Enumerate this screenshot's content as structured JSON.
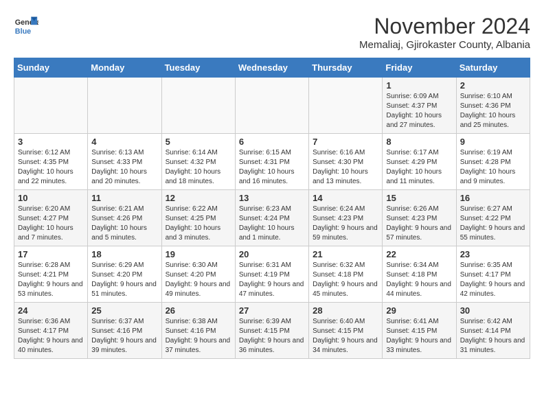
{
  "logo": {
    "general": "General",
    "blue": "Blue"
  },
  "title": "November 2024",
  "subtitle": "Memaliaj, Gjirokaster County, Albania",
  "days_of_week": [
    "Sunday",
    "Monday",
    "Tuesday",
    "Wednesday",
    "Thursday",
    "Friday",
    "Saturday"
  ],
  "weeks": [
    [
      {
        "day": "",
        "info": ""
      },
      {
        "day": "",
        "info": ""
      },
      {
        "day": "",
        "info": ""
      },
      {
        "day": "",
        "info": ""
      },
      {
        "day": "",
        "info": ""
      },
      {
        "day": "1",
        "info": "Sunrise: 6:09 AM\nSunset: 4:37 PM\nDaylight: 10 hours and 27 minutes."
      },
      {
        "day": "2",
        "info": "Sunrise: 6:10 AM\nSunset: 4:36 PM\nDaylight: 10 hours and 25 minutes."
      }
    ],
    [
      {
        "day": "3",
        "info": "Sunrise: 6:12 AM\nSunset: 4:35 PM\nDaylight: 10 hours and 22 minutes."
      },
      {
        "day": "4",
        "info": "Sunrise: 6:13 AM\nSunset: 4:33 PM\nDaylight: 10 hours and 20 minutes."
      },
      {
        "day": "5",
        "info": "Sunrise: 6:14 AM\nSunset: 4:32 PM\nDaylight: 10 hours and 18 minutes."
      },
      {
        "day": "6",
        "info": "Sunrise: 6:15 AM\nSunset: 4:31 PM\nDaylight: 10 hours and 16 minutes."
      },
      {
        "day": "7",
        "info": "Sunrise: 6:16 AM\nSunset: 4:30 PM\nDaylight: 10 hours and 13 minutes."
      },
      {
        "day": "8",
        "info": "Sunrise: 6:17 AM\nSunset: 4:29 PM\nDaylight: 10 hours and 11 minutes."
      },
      {
        "day": "9",
        "info": "Sunrise: 6:19 AM\nSunset: 4:28 PM\nDaylight: 10 hours and 9 minutes."
      }
    ],
    [
      {
        "day": "10",
        "info": "Sunrise: 6:20 AM\nSunset: 4:27 PM\nDaylight: 10 hours and 7 minutes."
      },
      {
        "day": "11",
        "info": "Sunrise: 6:21 AM\nSunset: 4:26 PM\nDaylight: 10 hours and 5 minutes."
      },
      {
        "day": "12",
        "info": "Sunrise: 6:22 AM\nSunset: 4:25 PM\nDaylight: 10 hours and 3 minutes."
      },
      {
        "day": "13",
        "info": "Sunrise: 6:23 AM\nSunset: 4:24 PM\nDaylight: 10 hours and 1 minute."
      },
      {
        "day": "14",
        "info": "Sunrise: 6:24 AM\nSunset: 4:23 PM\nDaylight: 9 hours and 59 minutes."
      },
      {
        "day": "15",
        "info": "Sunrise: 6:26 AM\nSunset: 4:23 PM\nDaylight: 9 hours and 57 minutes."
      },
      {
        "day": "16",
        "info": "Sunrise: 6:27 AM\nSunset: 4:22 PM\nDaylight: 9 hours and 55 minutes."
      }
    ],
    [
      {
        "day": "17",
        "info": "Sunrise: 6:28 AM\nSunset: 4:21 PM\nDaylight: 9 hours and 53 minutes."
      },
      {
        "day": "18",
        "info": "Sunrise: 6:29 AM\nSunset: 4:20 PM\nDaylight: 9 hours and 51 minutes."
      },
      {
        "day": "19",
        "info": "Sunrise: 6:30 AM\nSunset: 4:20 PM\nDaylight: 9 hours and 49 minutes."
      },
      {
        "day": "20",
        "info": "Sunrise: 6:31 AM\nSunset: 4:19 PM\nDaylight: 9 hours and 47 minutes."
      },
      {
        "day": "21",
        "info": "Sunrise: 6:32 AM\nSunset: 4:18 PM\nDaylight: 9 hours and 45 minutes."
      },
      {
        "day": "22",
        "info": "Sunrise: 6:34 AM\nSunset: 4:18 PM\nDaylight: 9 hours and 44 minutes."
      },
      {
        "day": "23",
        "info": "Sunrise: 6:35 AM\nSunset: 4:17 PM\nDaylight: 9 hours and 42 minutes."
      }
    ],
    [
      {
        "day": "24",
        "info": "Sunrise: 6:36 AM\nSunset: 4:17 PM\nDaylight: 9 hours and 40 minutes."
      },
      {
        "day": "25",
        "info": "Sunrise: 6:37 AM\nSunset: 4:16 PM\nDaylight: 9 hours and 39 minutes."
      },
      {
        "day": "26",
        "info": "Sunrise: 6:38 AM\nSunset: 4:16 PM\nDaylight: 9 hours and 37 minutes."
      },
      {
        "day": "27",
        "info": "Sunrise: 6:39 AM\nSunset: 4:15 PM\nDaylight: 9 hours and 36 minutes."
      },
      {
        "day": "28",
        "info": "Sunrise: 6:40 AM\nSunset: 4:15 PM\nDaylight: 9 hours and 34 minutes."
      },
      {
        "day": "29",
        "info": "Sunrise: 6:41 AM\nSunset: 4:15 PM\nDaylight: 9 hours and 33 minutes."
      },
      {
        "day": "30",
        "info": "Sunrise: 6:42 AM\nSunset: 4:14 PM\nDaylight: 9 hours and 31 minutes."
      }
    ]
  ]
}
